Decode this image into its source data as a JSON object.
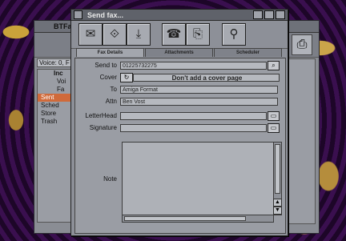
{
  "background_window": {
    "title": "BTFa",
    "voice_label": "Voice: 0, F",
    "folders": [
      "Inc",
      "Voi",
      "Fa",
      "Sent",
      "Sched",
      "Store",
      "Trash"
    ],
    "selected_folder": "Sent"
  },
  "dialog": {
    "title": "Send fax...",
    "tabs": [
      "Fax Details",
      "Attachments",
      "Scheduler"
    ],
    "active_tab": "Fax Details",
    "toolbar_icons": [
      "send-fax-icon",
      "preview-icon",
      "download-icon",
      "fax-machine-icon",
      "fax-options-icon",
      "scanner-icon"
    ],
    "fields": {
      "send_to": {
        "label": "Send to",
        "value": "01225732275"
      },
      "cover": {
        "label": "Cover",
        "value": "Don't add a cover page"
      },
      "to": {
        "label": "To",
        "value": "Amiga Format"
      },
      "attn": {
        "label": "Attn",
        "value": "Ben Vost"
      },
      "letterhead": {
        "label": "LetterHead",
        "value": ""
      },
      "signature": {
        "label": "Signature",
        "value": ""
      },
      "note": {
        "label": "Note",
        "value": ""
      }
    }
  },
  "colors": {
    "window_bg": "#8d9098",
    "selection": "#d06a3a",
    "titlebar": "#5f626a"
  }
}
